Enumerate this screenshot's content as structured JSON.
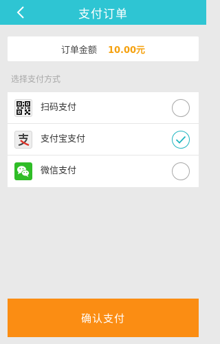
{
  "header": {
    "title": "支付订单",
    "back_icon": "chevron-left-icon",
    "background": "#2ec5d3"
  },
  "order": {
    "amount_label": "订单金额",
    "amount_value": "10.00元",
    "amount_color": "#f5a10f"
  },
  "payment": {
    "section_label": "选择支付方式",
    "methods": [
      {
        "label": "扫码支付",
        "icon": "qr-code-icon",
        "selected": false
      },
      {
        "label": "支付宝支付",
        "icon": "alipay-icon",
        "selected": true
      },
      {
        "label": "微信支付",
        "icon": "wechat-icon",
        "selected": false
      }
    ],
    "check_color": "#1fb5c0"
  },
  "footer": {
    "confirm_label": "确认支付",
    "confirm_color": "#fb8d13"
  }
}
